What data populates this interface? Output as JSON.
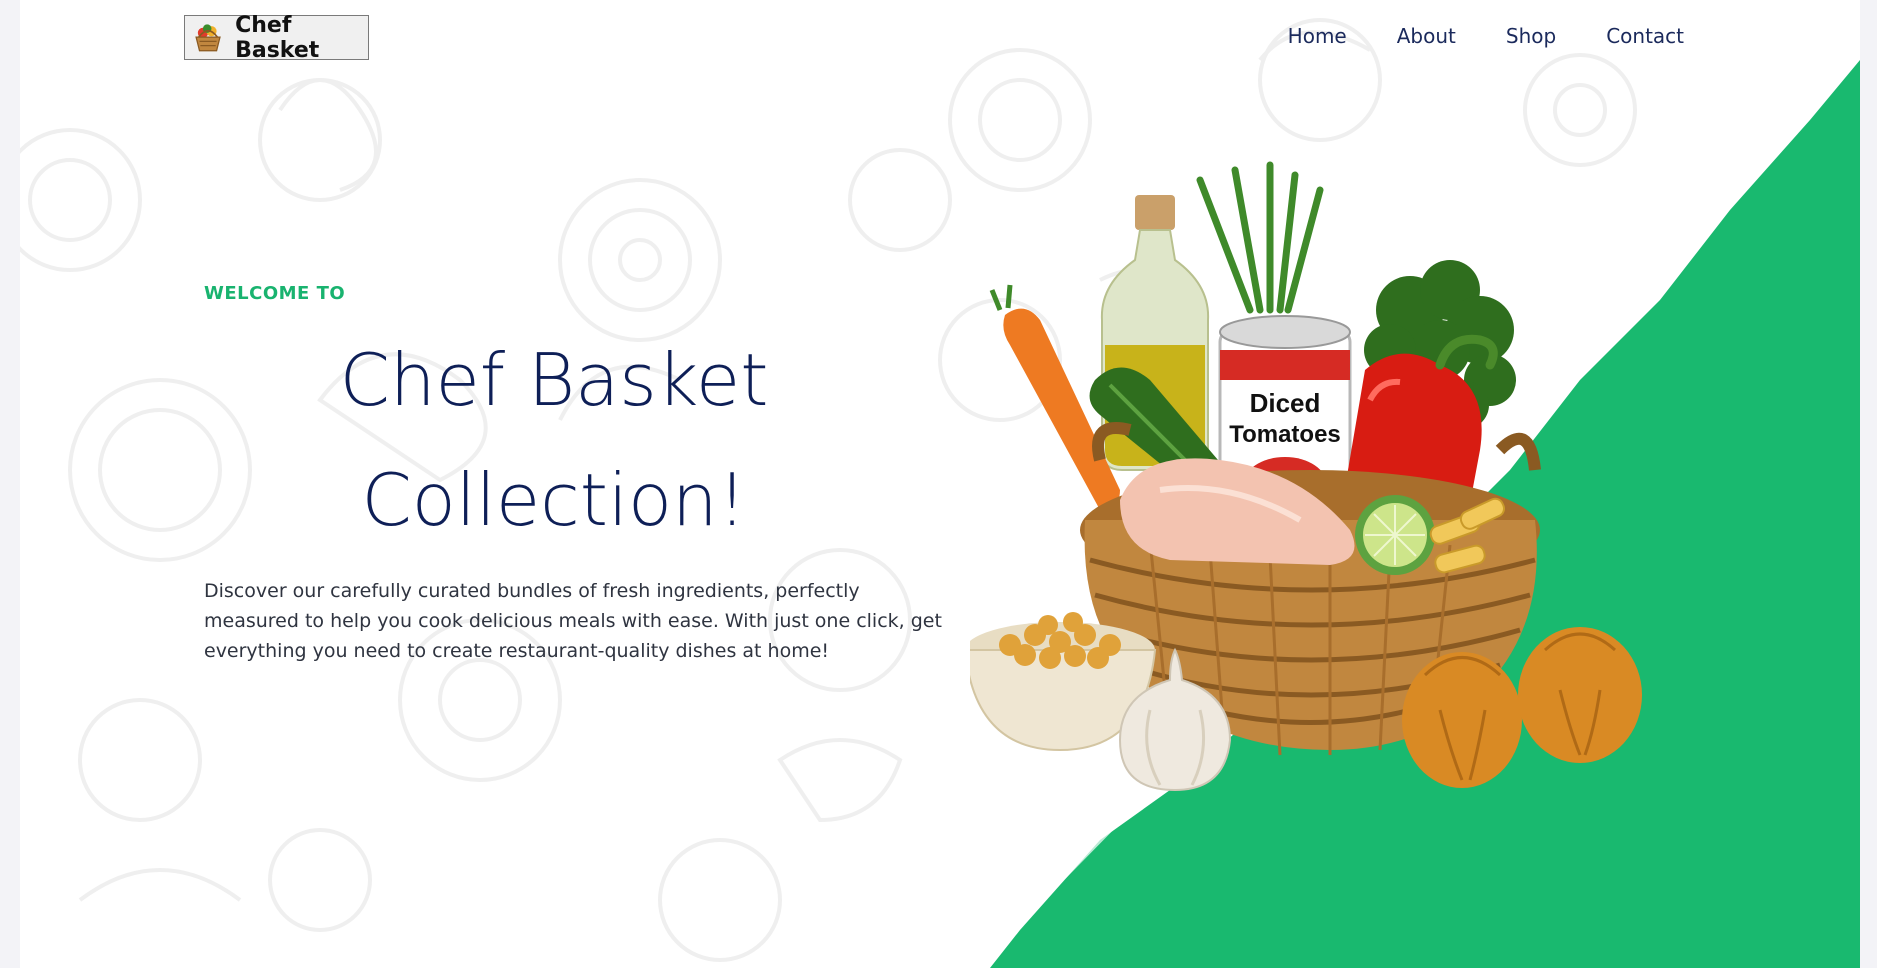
{
  "brand": {
    "name": "Chef Basket",
    "logo_icon": "basket-logo-icon"
  },
  "nav": {
    "home": "Home",
    "about": "About",
    "shop": "Shop",
    "contact": "Contact"
  },
  "hero": {
    "eyebrow": "WELCOME TO",
    "title_line1": "Chef Basket",
    "title_line2": "Collection!",
    "description": "Discover our carefully curated bundles of fresh ingredients, perfectly measured to help you cook delicious meals with ease. With just one click, get everything you need to create restaurant-quality dishes at home!",
    "can_label_line1": "Diced",
    "can_label_line2": "Tomatoes"
  },
  "colors": {
    "accent": "#19b36f",
    "heading": "#0e1f57",
    "nav": "#1b2a5c",
    "body_text": "#2f3440"
  }
}
